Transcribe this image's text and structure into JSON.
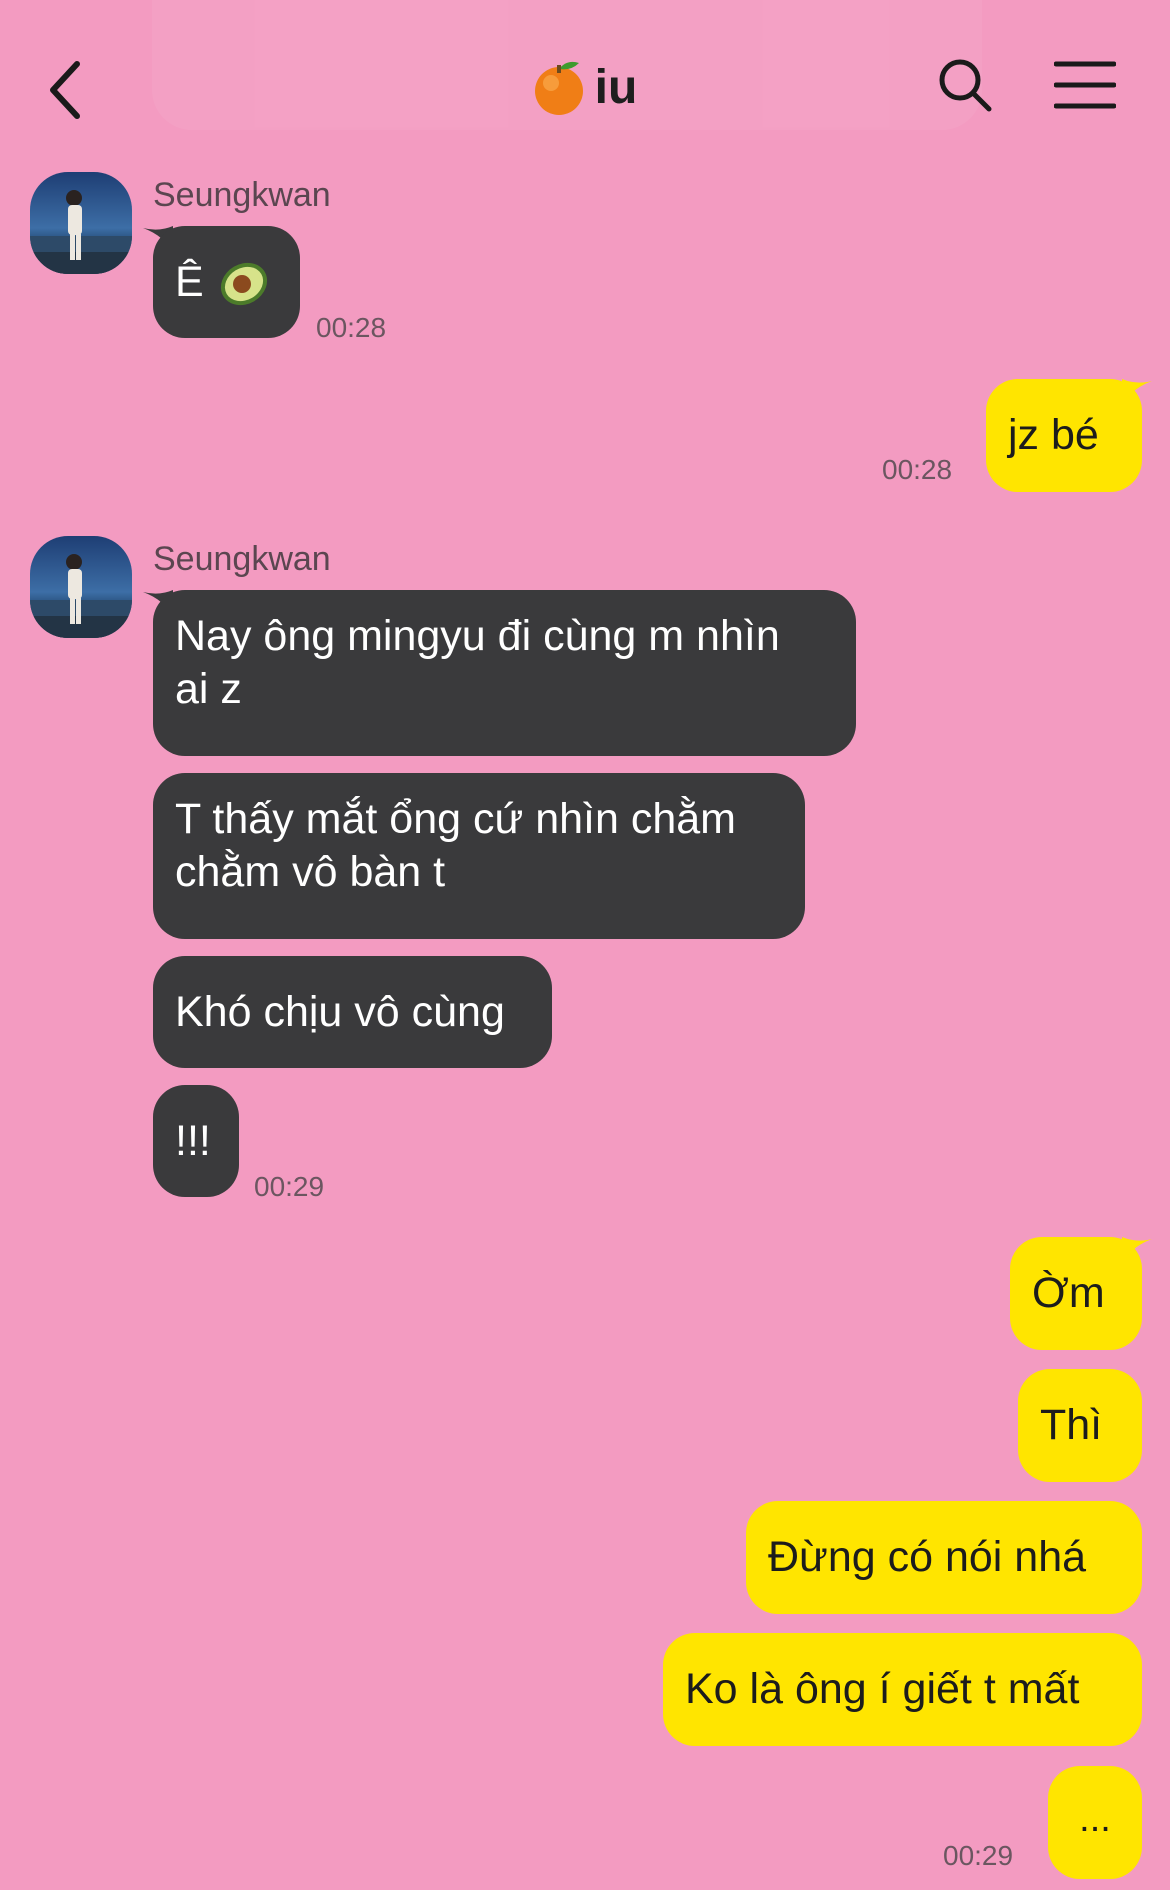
{
  "header": {
    "title_emoji": "orange-icon",
    "title": "iu",
    "back": "back-icon",
    "search": "search-icon",
    "menu": "menu-icon",
    "background_color": "#F39BC1"
  },
  "colors": {
    "incoming_bubble": "#3A3A3C",
    "outgoing_bubble": "#FFE500",
    "background": "#F39BC1"
  },
  "messages": {
    "group1": {
      "sender": "Seungkwan",
      "m1": {
        "text": "Ê",
        "emoji": "avocado-icon"
      },
      "time": "00:28"
    },
    "out1": {
      "m1": "jz bé",
      "time": "00:28"
    },
    "group2": {
      "sender": "Seungkwan",
      "m1_line1": "Nay ông mingyu đi cùng m nhìn",
      "m1_line2": "ai z",
      "m2_line1": "T thấy mắt ổng cứ nhìn chằm",
      "m2_line2": "chằm vô bàn t",
      "m3": "Khó chịu vô cùng",
      "m4": "!!!",
      "time": "00:29"
    },
    "out2": {
      "m1": "Ờm",
      "m2": "Thì",
      "m3": "Đừng có nói nhá",
      "m4": "Ko là ông í giết t mất",
      "m5": "...",
      "time": "00:29"
    }
  }
}
